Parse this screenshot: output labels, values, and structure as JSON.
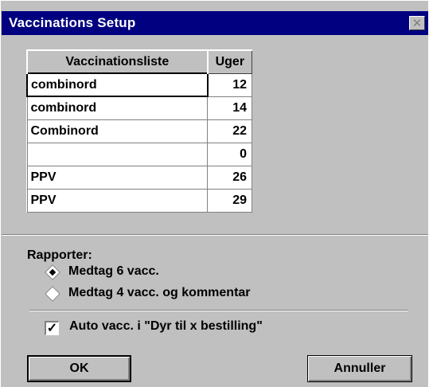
{
  "window": {
    "title": "Vaccinations Setup",
    "close_glyph": "✕"
  },
  "table": {
    "headers": [
      "Vaccinationsliste",
      "Uger"
    ],
    "rows": [
      {
        "name": "combinord",
        "weeks": "12"
      },
      {
        "name": "combinord",
        "weeks": "14"
      },
      {
        "name": "Combinord",
        "weeks": "22"
      },
      {
        "name": "",
        "weeks": "0"
      },
      {
        "name": "PPV",
        "weeks": "26"
      },
      {
        "name": "PPV",
        "weeks": "29"
      }
    ]
  },
  "reports": {
    "label": "Rapporter:",
    "options": [
      {
        "label": "Medtag 6 vacc.",
        "selected": true
      },
      {
        "label": "Medtag 4 vacc. og kommentar",
        "selected": false
      }
    ]
  },
  "auto": {
    "checkbox_label": "Auto vacc. i \"Dyr til x bestilling\"",
    "checked": true,
    "check_glyph": "✓"
  },
  "buttons": {
    "ok": "OK",
    "cancel": "Annuller"
  }
}
